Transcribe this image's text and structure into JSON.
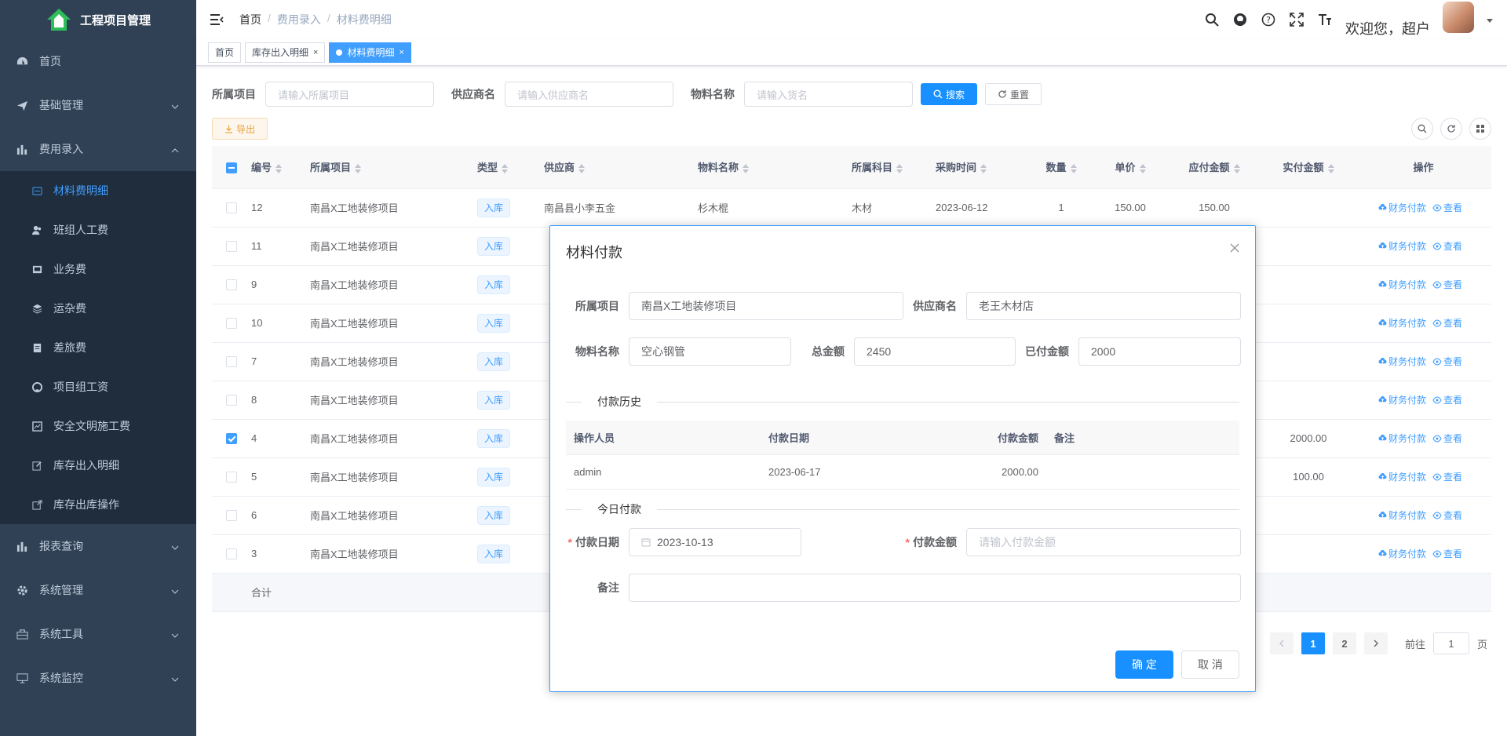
{
  "app": {
    "title": "工程项目管理"
  },
  "sidebar": {
    "items": [
      {
        "label": "首页",
        "icon": "dashboard-icon"
      },
      {
        "label": "基础管理",
        "icon": "send-icon",
        "chevron": "down"
      },
      {
        "label": "费用录入",
        "icon": "bar-chart-icon",
        "chevron": "up"
      }
    ],
    "submenu": [
      {
        "label": "材料费明细",
        "icon": "list-icon",
        "active": true
      },
      {
        "label": "班组人工费",
        "icon": "team-icon"
      },
      {
        "label": "业务费",
        "icon": "monitor-icon"
      },
      {
        "label": "运杂费",
        "icon": "layers-icon"
      },
      {
        "label": "差旅费",
        "icon": "document-icon"
      },
      {
        "label": "项目组工资",
        "icon": "github-icon"
      },
      {
        "label": "安全文明施工费",
        "icon": "chart-box-icon"
      },
      {
        "label": "库存出入明细",
        "icon": "edit-icon"
      },
      {
        "label": "库存出库操作",
        "icon": "external-link-icon"
      }
    ],
    "items_after": [
      {
        "label": "报表查询",
        "icon": "bar-chart-icon"
      },
      {
        "label": "系统管理",
        "icon": "gear-icon"
      },
      {
        "label": "系统工具",
        "icon": "toolbox-icon"
      },
      {
        "label": "系统监控",
        "icon": "monitor-icon"
      }
    ]
  },
  "navbar": {
    "breadcrumb": [
      "首页",
      "费用录入",
      "材料费明细"
    ],
    "separator": "/",
    "welcome": "欢迎您，超户"
  },
  "tags": [
    {
      "label": "首页"
    },
    {
      "label": "库存出入明细",
      "close": "×"
    },
    {
      "label": "材料费明细",
      "close": "×",
      "active": true
    }
  ],
  "search": {
    "project_label": "所属项目",
    "project_placeholder": "请输入所属项目",
    "supplier_label": "供应商名",
    "supplier_placeholder": "请输入供应商名",
    "material_label": "物料名称",
    "material_placeholder": "请输入货名",
    "search_btn": "搜索",
    "reset_btn": "重置"
  },
  "toolbar": {
    "export_btn": "导出"
  },
  "table": {
    "headers": [
      "编号",
      "所属项目",
      "类型",
      "供应商",
      "物料名称",
      "所属科目",
      "采购时间",
      "数量",
      "单价",
      "应付金额",
      "实付金额",
      "操作"
    ],
    "rows": [
      {
        "id": "12",
        "project": "南昌X工地装修项目",
        "type": "入库",
        "supplier": "南昌县小李五金",
        "material": "杉木棍",
        "subject": "木材",
        "date": "2023-06-12",
        "qty": "1",
        "price": "150.00",
        "payable": "150.00",
        "paid": "",
        "checked": false
      },
      {
        "id": "11",
        "project": "南昌X工地装修项目",
        "type": "入库",
        "paid": "",
        "checked": false
      },
      {
        "id": "9",
        "project": "南昌X工地装修项目",
        "type": "入库",
        "paid": "",
        "checked": false
      },
      {
        "id": "10",
        "project": "南昌X工地装修项目",
        "type": "入库",
        "paid": "",
        "checked": false
      },
      {
        "id": "7",
        "project": "南昌X工地装修项目",
        "type": "入库",
        "paid": "",
        "checked": false
      },
      {
        "id": "8",
        "project": "南昌X工地装修项目",
        "type": "入库",
        "paid": "",
        "checked": false
      },
      {
        "id": "4",
        "project": "南昌X工地装修项目",
        "type": "入库",
        "paid": "2000.00",
        "checked": true
      },
      {
        "id": "5",
        "project": "南昌X工地装修项目",
        "type": "入库",
        "paid": "100.00",
        "checked": false
      },
      {
        "id": "6",
        "project": "南昌X工地装修项目",
        "type": "入库",
        "paid": "",
        "checked": false
      },
      {
        "id": "3",
        "project": "南昌X工地装修项目",
        "type": "入库",
        "paid": "",
        "checked": false
      }
    ],
    "op_pay": "财务付款",
    "op_view": "查看",
    "sum_label": "合计"
  },
  "pager": {
    "pages": [
      "1",
      "2"
    ],
    "current": "1",
    "goto_label": "前往",
    "goto_value": "1",
    "page_unit": "页"
  },
  "dialog": {
    "title": "材料付款",
    "project_label": "所属项目",
    "project_value": "南昌X工地装修项目",
    "supplier_label": "供应商名",
    "supplier_value": "老王木材店",
    "material_label": "物料名称",
    "material_value": "空心钢管",
    "total_label": "总金额",
    "total_value": "2450",
    "paid_label": "已付金额",
    "paid_value": "2000",
    "history_title": "付款历史",
    "history_headers": [
      "操作人员",
      "付款日期",
      "付款金额",
      "备注"
    ],
    "history_rows": [
      {
        "operator": "admin",
        "date": "2023-06-17",
        "amount": "2000.00",
        "note": ""
      }
    ],
    "today_title": "今日付款",
    "pay_date_label": "付款日期",
    "pay_date_value": "2023-10-13",
    "pay_amount_label": "付款金额",
    "pay_amount_placeholder": "请输入付款金额",
    "note_label": "备注",
    "confirm_btn": "确 定",
    "cancel_btn": "取 消"
  },
  "colors": {
    "sidebar_bg": "#304156",
    "submenu_bg": "#1f2d3d",
    "primary": "#1890ff",
    "active_text": "#409eff",
    "warning": "#e6a23c"
  }
}
